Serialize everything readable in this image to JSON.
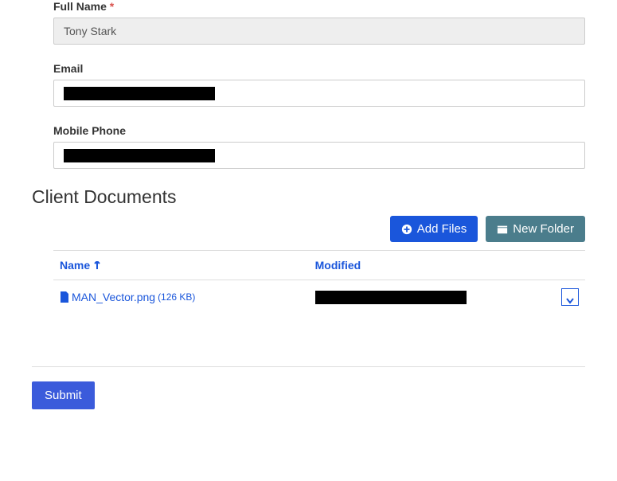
{
  "form": {
    "fullName": {
      "label": "Full Name",
      "required": true,
      "value": "Tony Stark"
    },
    "email": {
      "label": "Email",
      "value": ""
    },
    "mobilePhone": {
      "label": "Mobile Phone",
      "value": ""
    }
  },
  "documents": {
    "heading": "Client Documents",
    "toolbar": {
      "addFiles": "Add Files",
      "newFolder": "New Folder"
    },
    "columns": {
      "name": "Name",
      "modified": "Modified"
    },
    "rows": [
      {
        "filename": "MAN_Vector.png",
        "size": "(126 KB)",
        "modified": ""
      }
    ]
  },
  "submit": {
    "label": "Submit"
  },
  "colors": {
    "primary": "#1a56db",
    "teal": "#4b7d8c",
    "submit": "#3b5bdb"
  }
}
